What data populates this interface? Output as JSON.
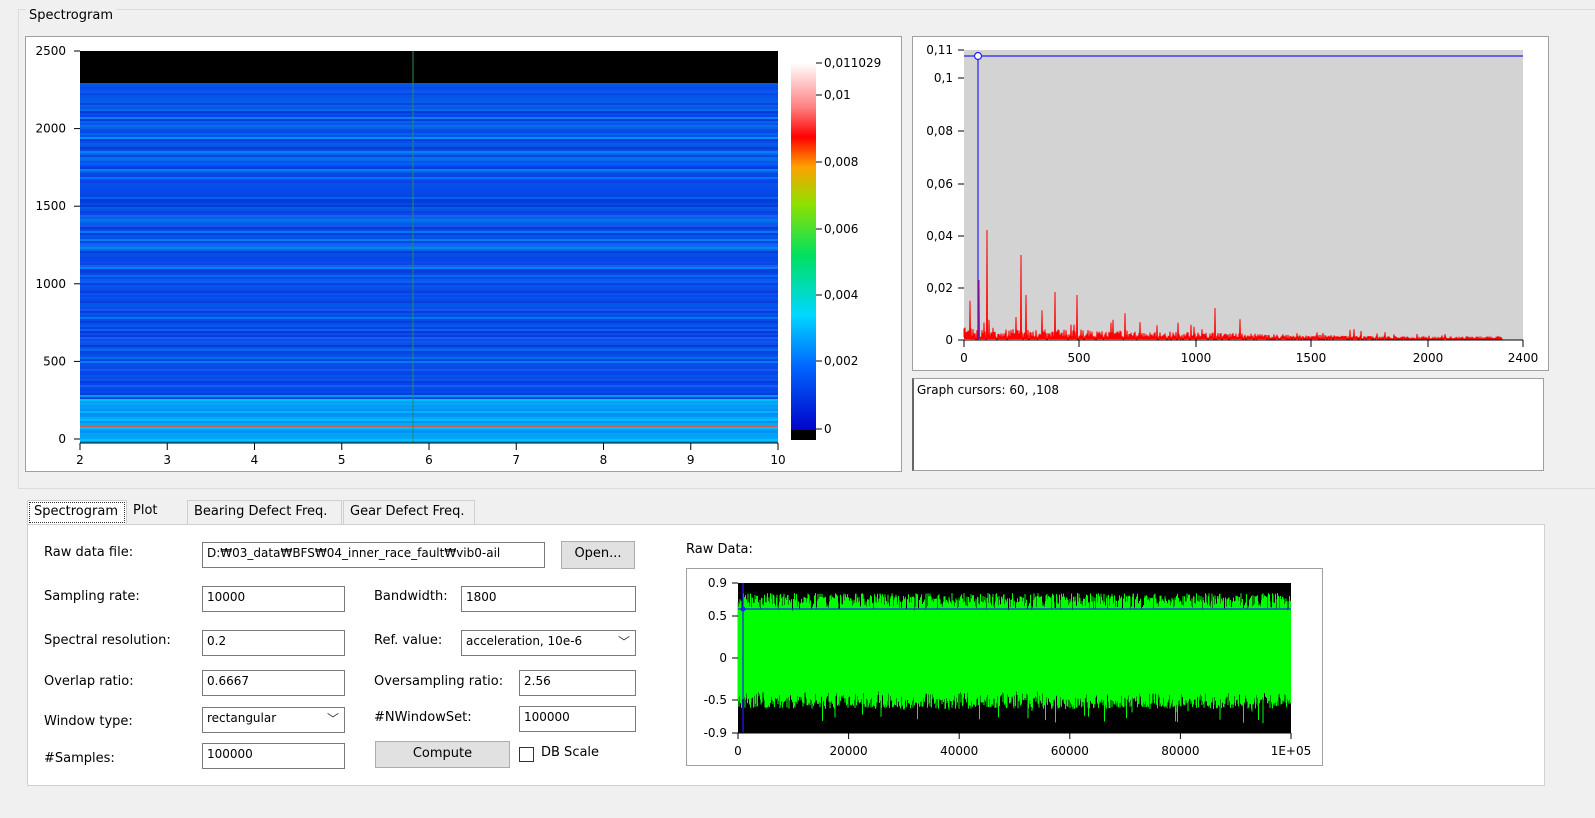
{
  "spectrogram_group_title": "Spectrogram",
  "spectrogram_plot": {
    "y_ticks": [
      "2500",
      "2000",
      "1500",
      "1000",
      "500",
      "0"
    ],
    "x_ticks": [
      "2",
      "3",
      "4",
      "5",
      "6",
      "7",
      "8",
      "9",
      "10"
    ],
    "colorbar_ticks": [
      "0,011029",
      "0,01",
      "0,008",
      "0,006",
      "0,004",
      "0,002",
      "0"
    ],
    "colors": {
      "background": "#0a3fe0",
      "black_band": "#000000",
      "cursor_line": "#2e8b57"
    }
  },
  "spectrum_plot": {
    "y_ticks": [
      "0,11",
      "0,1",
      "0,08",
      "0,06",
      "0,04",
      "0,02",
      "0"
    ],
    "x_ticks": [
      "0",
      "500",
      "1000",
      "1500",
      "2000",
      "2400"
    ],
    "colors": {
      "background": "#d3d3d3",
      "signal": "#ff0000",
      "cursor": "#2020ff"
    }
  },
  "cursor_readout": "Graph cursors: 60, ,108",
  "tabs": [
    {
      "label": "Spectrogram",
      "active": true
    },
    {
      "label": "Plot",
      "active": false
    },
    {
      "label": "Bearing Defect Freq.",
      "active": false
    },
    {
      "label": "Gear Defect Freq.",
      "active": false
    }
  ],
  "form": {
    "raw_data_file_label": "Raw data file:",
    "raw_data_file_value": "D:₩03_data₩BFS₩04_inner_race_fault₩vib0-ail",
    "open_button": "Open...",
    "sampling_rate_label": "Sampling rate:",
    "sampling_rate_value": "10000",
    "bandwidth_label": "Bandwidth:",
    "bandwidth_value": "1800",
    "spectral_resolution_label": "Spectral resolution:",
    "spectral_resolution_value": "0.2",
    "ref_value_label": "Ref. value:",
    "ref_value_value": "acceleration, 10e-6",
    "overlap_ratio_label": "Overlap ratio:",
    "overlap_ratio_value": "0.6667",
    "oversampling_ratio_label": "Oversampling ratio:",
    "oversampling_ratio_value": "2.56",
    "window_type_label": "Window type:",
    "window_type_value": "rectangular",
    "nwindowset_label": "#NWindowSet:",
    "nwindowset_value": "100000",
    "samples_label": "#Samples:",
    "samples_value": "100000",
    "compute_button": "Compute",
    "db_scale_label": "DB Scale",
    "db_scale_checked": false
  },
  "raw_data_plot": {
    "title": "Raw Data:",
    "y_ticks": [
      "0.9",
      "0.5",
      "0",
      "-0.5",
      "-0.9"
    ],
    "x_ticks": [
      "0",
      "20000",
      "40000",
      "60000",
      "80000",
      "1E+05"
    ],
    "colors": {
      "background": "#000000",
      "signal": "#00ff00",
      "cursor": "#2020ff"
    }
  }
}
